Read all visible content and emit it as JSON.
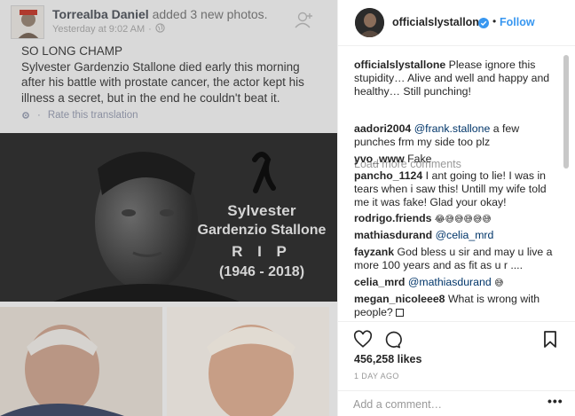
{
  "facebook_post": {
    "author": "Torrealba Daniel",
    "action": "added 3 new photos.",
    "timestamp": "Yesterday at 9:02 AM",
    "privacy_icon": "globe-icon",
    "headline": "SO LONG CHAMP",
    "body": "Sylvester Gardenzio Stallone died early this morning after his battle with prostate cancer, the actor kept his illness a secret, but in the end he couldn't beat it.",
    "translate_label": "Rate this translation",
    "memorial": {
      "line1": "Sylvester",
      "line2": "Gardenzio Stallone",
      "line3": "R I P",
      "line4": "(1946 - 2018)"
    }
  },
  "instagram": {
    "username": "officialslystallone",
    "follow_label": "Follow",
    "dot": "•",
    "load_more": "Load more comments",
    "caption": {
      "user": "officialslystallone",
      "text": "Please ignore this stupidity… Alive and well and happy and healthy… Still punching!"
    },
    "comments": [
      {
        "user": "aadori2004",
        "mention": "@frank.stallone",
        "text": "a few punches frm my side too plz"
      },
      {
        "user": "yvo_www",
        "text": "Fake"
      },
      {
        "user": "pancho_1124",
        "text": "I ant going to lie! I was in tears when i saw this! Untill my wife told me it was fake! Glad your okay!"
      },
      {
        "user": "rodrigo.friends",
        "text": "😂😅😅😅😅😅"
      },
      {
        "user": "mathiasdurand",
        "mention": "@celia_mrd"
      },
      {
        "user": "fayzank",
        "text": "God bless u sir and may u live a more 100 years and as fit as u r ...."
      },
      {
        "user": "celia_mrd",
        "mention": "@mathiasdurand",
        "text": "😅"
      },
      {
        "user": "megan_nicoleee8",
        "text": "What is wrong with people?"
      }
    ],
    "likes": "456,258 likes",
    "time_ago": "1 DAY AGO",
    "comment_placeholder": "Add a comment…",
    "more_label": "•••",
    "colors": {
      "link_blue": "#3897f0",
      "mention_blue": "#003569",
      "muted_gray": "#999999"
    }
  }
}
